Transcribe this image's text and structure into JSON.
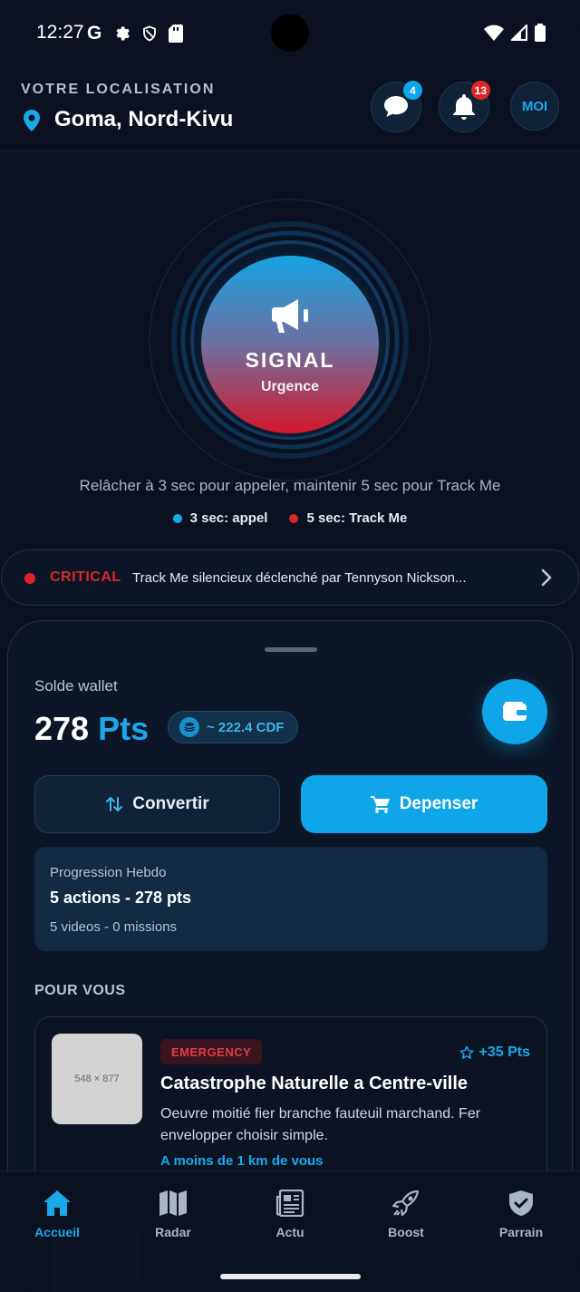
{
  "status_bar": {
    "time": "12:27",
    "g_label": "G"
  },
  "header": {
    "location_label": "VOTRE LOCALISATION",
    "city": "Goma, Nord-Kivu",
    "chat_badge": "4",
    "notif_badge": "13",
    "profile_label": "MOI"
  },
  "signal": {
    "title": "SIGNAL",
    "subtitle": "Urgence",
    "hint": "Relâcher à 3 sec pour appeler, maintenir 5 sec pour Track Me",
    "legend": [
      {
        "label": "3 sec: appel",
        "color": "#1aa8ea"
      },
      {
        "label": "5 sec: Track Me",
        "color": "#dc2626"
      }
    ]
  },
  "alert": {
    "level": "CRITICAL",
    "message": "Track Me silencieux déclenché par Tennyson Nickson..."
  },
  "wallet": {
    "label": "Solde wallet",
    "points_value": "278",
    "points_unit": "Pts",
    "cdf": "~ 222.4 CDF",
    "convert_label": "Convertir",
    "spend_label": "Depenser",
    "progress": {
      "title": "Progression Hebdo",
      "main": "5 actions - 278 pts",
      "sub": "5 videos - 0 missions"
    }
  },
  "for_you": {
    "title": "POUR VOUS",
    "cards": [
      {
        "thumb_label": "548 × 877",
        "tag": "EMERGENCY",
        "points": "+35 Pts",
        "title": "Catastrophe Naturelle a Centre-ville",
        "description": "Oeuvre moitié fier branche fauteuil marchand. Fer envelopper choisir simple.",
        "distance": "A moins de 1 km de vous"
      }
    ]
  },
  "nav": [
    {
      "label": "Accueil",
      "icon": "home-icon",
      "active": true
    },
    {
      "label": "Radar",
      "icon": "map-icon",
      "active": false
    },
    {
      "label": "Actu",
      "icon": "newspaper-icon",
      "active": false
    },
    {
      "label": "Boost",
      "icon": "rocket-icon",
      "active": false
    },
    {
      "label": "Parrain",
      "icon": "shield-check-icon",
      "active": false
    }
  ],
  "colors": {
    "accent": "#1aa8ea",
    "danger": "#dc2626",
    "background": "#0b1120"
  }
}
